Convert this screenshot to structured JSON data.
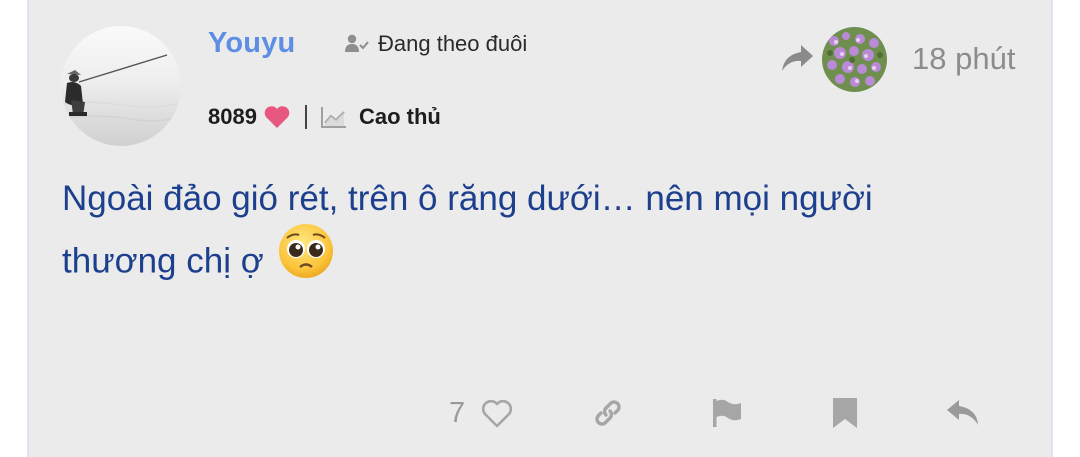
{
  "post": {
    "author": {
      "name": "Youyu",
      "follow_status": "Đang theo đuôi",
      "points": "8089",
      "rank": "Cao thủ",
      "avatar": "fisherman-avatar"
    },
    "time": "18 phút",
    "content": "Ngoài đảo gió rét, trên ô răng dưới… nên mọi người thương chị ợ",
    "emoji": "pleading-face",
    "likes": "7"
  },
  "icons": {
    "follow": "user-check-icon",
    "points": "heart-icon",
    "rank": "chart-icon",
    "share": "share-arrow-icon",
    "group": "flower-group-avatar",
    "like": "heart-outline-icon",
    "link": "link-icon",
    "flag": "flag-icon",
    "bookmark": "bookmark-icon",
    "reply": "reply-icon"
  },
  "colors": {
    "username": "#5d8ee3",
    "content": "#1c3f8e",
    "heart": "#e8577f",
    "action_icons": "#9a9a9a",
    "card_background": "#ebebeb"
  }
}
